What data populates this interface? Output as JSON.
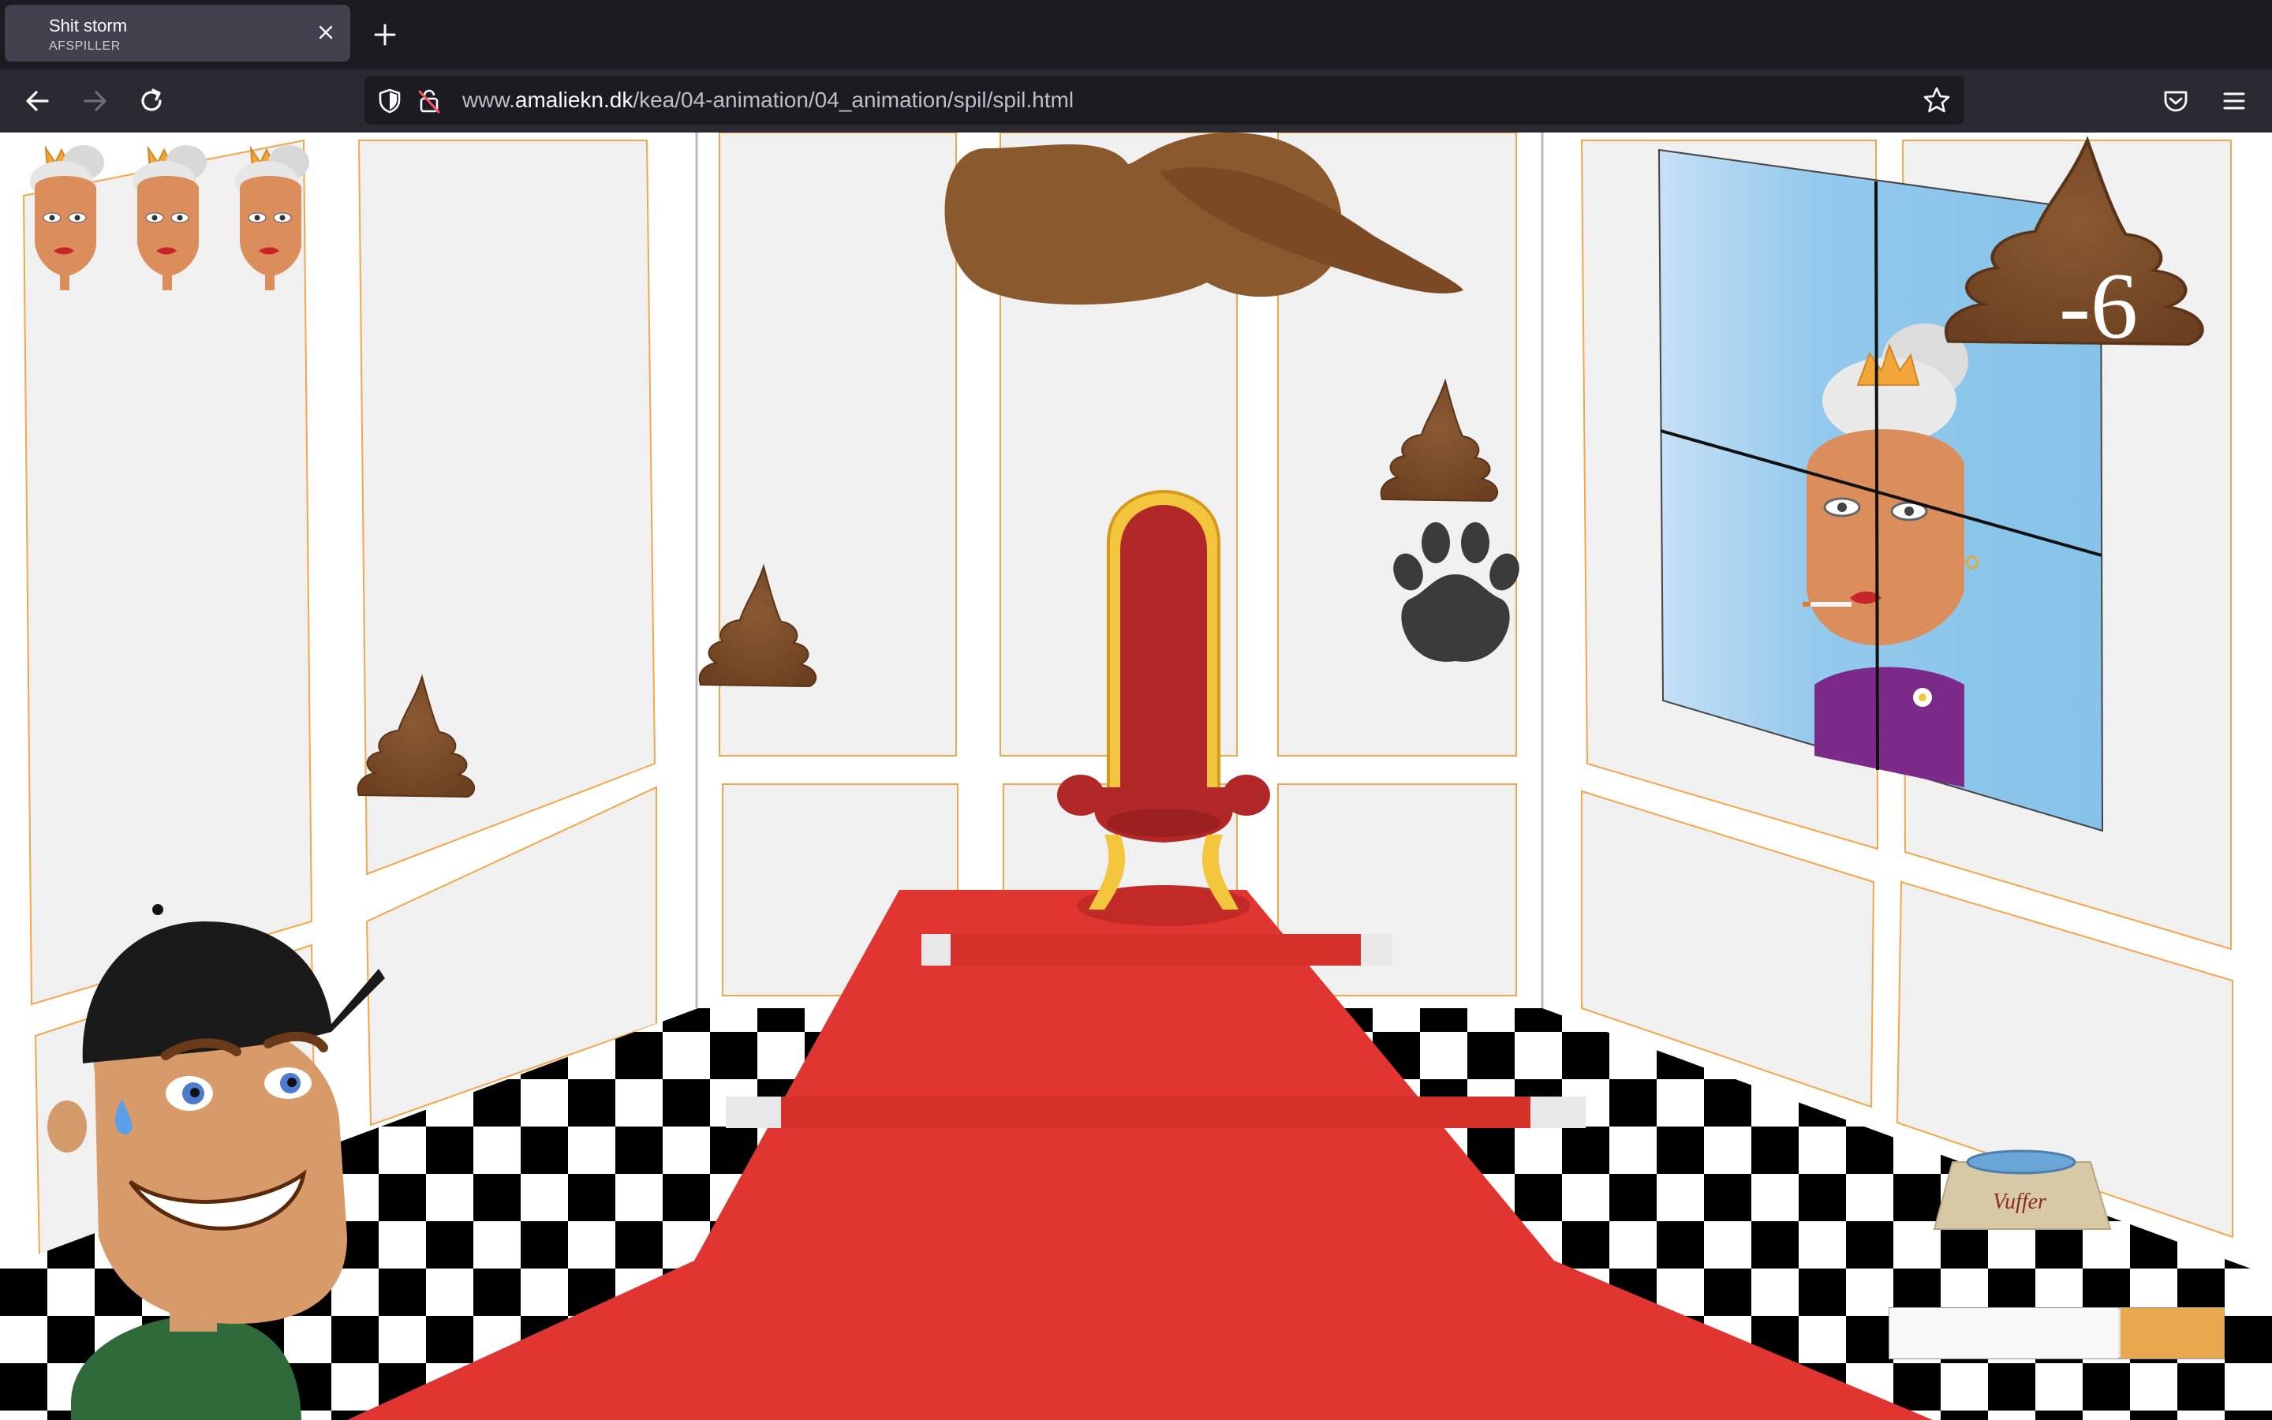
{
  "browser": {
    "tab": {
      "title": "Shit storm",
      "subtitle": "AFSPILLER"
    },
    "url": {
      "domain_prefix": "www.",
      "domain": "amaliekn.dk",
      "path": "/kea/04-animation/04_animation/spil/spil.html"
    }
  },
  "game": {
    "score": "-6",
    "lives": 3,
    "bowl_label": "Vuffer",
    "cigarette_meter": 0.68,
    "icons": [
      "poop-icon",
      "paw-print-icon",
      "queen-head-icon",
      "throne-icon",
      "dog-bowl-icon",
      "cigarette-icon"
    ],
    "colors": {
      "carpet": "#e03530",
      "poop": "#7a4a28",
      "window_sky": "#8ec6ea",
      "wall_panel": "#f0f0f0",
      "panel_border": "#f3a64a"
    }
  }
}
